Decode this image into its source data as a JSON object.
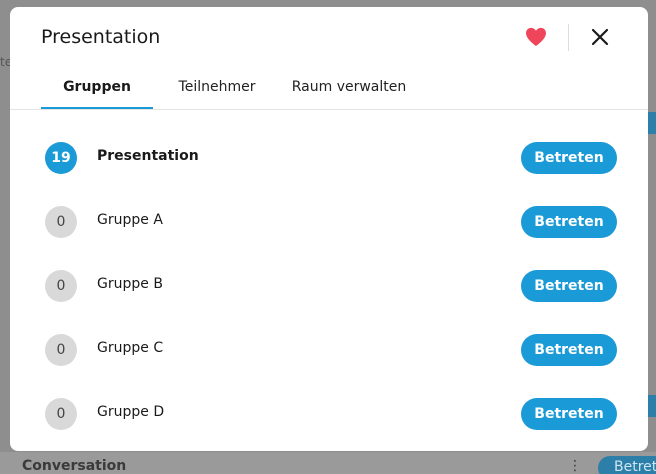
{
  "background": {
    "left_fragment": "te",
    "bottom_item": "Conversation",
    "bottom_menu": "⋮",
    "bottom_button": "Betret"
  },
  "modal": {
    "title": "Presentation",
    "favorite_icon": "heart-icon",
    "close_icon": "close-icon",
    "colors": {
      "accent": "#1a9ad6",
      "heart": "#f0445a",
      "badge_idle": "#d9d9d9"
    }
  },
  "tabs": [
    {
      "label": "Gruppen",
      "active": true
    },
    {
      "label": "Teilnehmer",
      "active": false
    },
    {
      "label": "Raum verwalten",
      "active": false
    }
  ],
  "groups": [
    {
      "count": "19",
      "name": "Presentation",
      "button": "Betreten",
      "active": true
    },
    {
      "count": "0",
      "name": "Gruppe A",
      "button": "Betreten",
      "active": false
    },
    {
      "count": "0",
      "name": "Gruppe B",
      "button": "Betreten",
      "active": false
    },
    {
      "count": "0",
      "name": "Gruppe C",
      "button": "Betreten",
      "active": false
    },
    {
      "count": "0",
      "name": "Gruppe D",
      "button": "Betreten",
      "active": false
    }
  ]
}
